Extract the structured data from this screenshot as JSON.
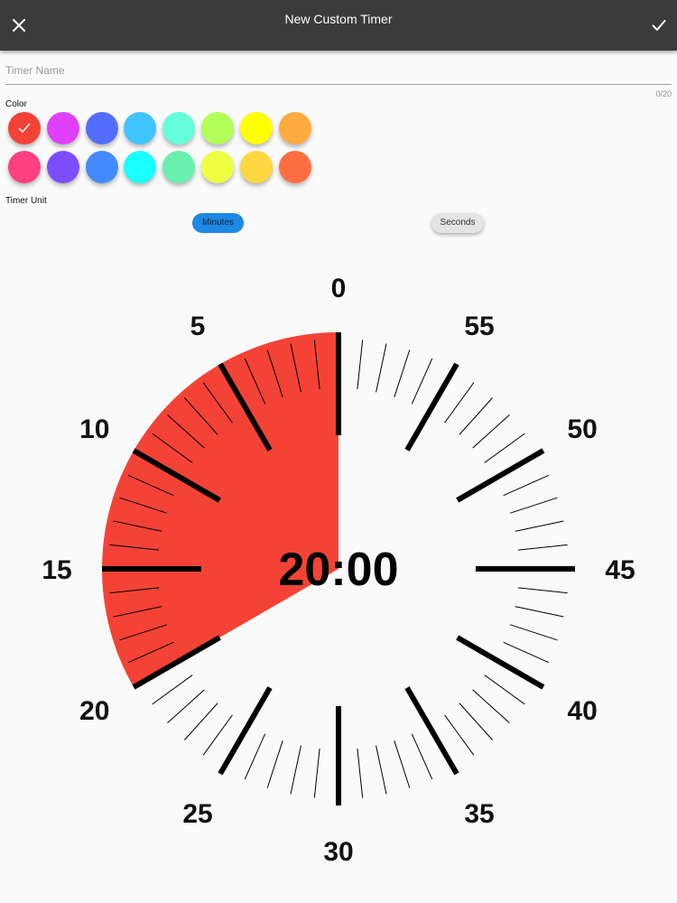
{
  "appbar": {
    "title": "New Custom Timer",
    "close_icon": "close-icon",
    "confirm_icon": "check-icon"
  },
  "timer_name": {
    "placeholder": "Timer Name",
    "value": "",
    "counter": "0/20"
  },
  "color_section": {
    "label": "Color",
    "selected_index": 0,
    "swatches": [
      "#f44336",
      "#e040fb",
      "#536dfe",
      "#40c4ff",
      "#64ffda",
      "#b2ff59",
      "#ffff00",
      "#ffab40",
      "#ff4081",
      "#7c4dff",
      "#448aff",
      "#18ffff",
      "#69f0ae",
      "#eeff41",
      "#ffd740",
      "#ff6e40"
    ]
  },
  "unit_section": {
    "label": "Timer Unit",
    "options": [
      "Minutes",
      "Seconds"
    ],
    "selected": "Minutes"
  },
  "dial": {
    "display_time": "20:00",
    "set_minutes": 20,
    "max_minutes": 60,
    "fill_color": "#f44336",
    "labels": [
      "0",
      "55",
      "50",
      "45",
      "40",
      "35",
      "30",
      "25",
      "20",
      "15",
      "10",
      "5"
    ]
  }
}
